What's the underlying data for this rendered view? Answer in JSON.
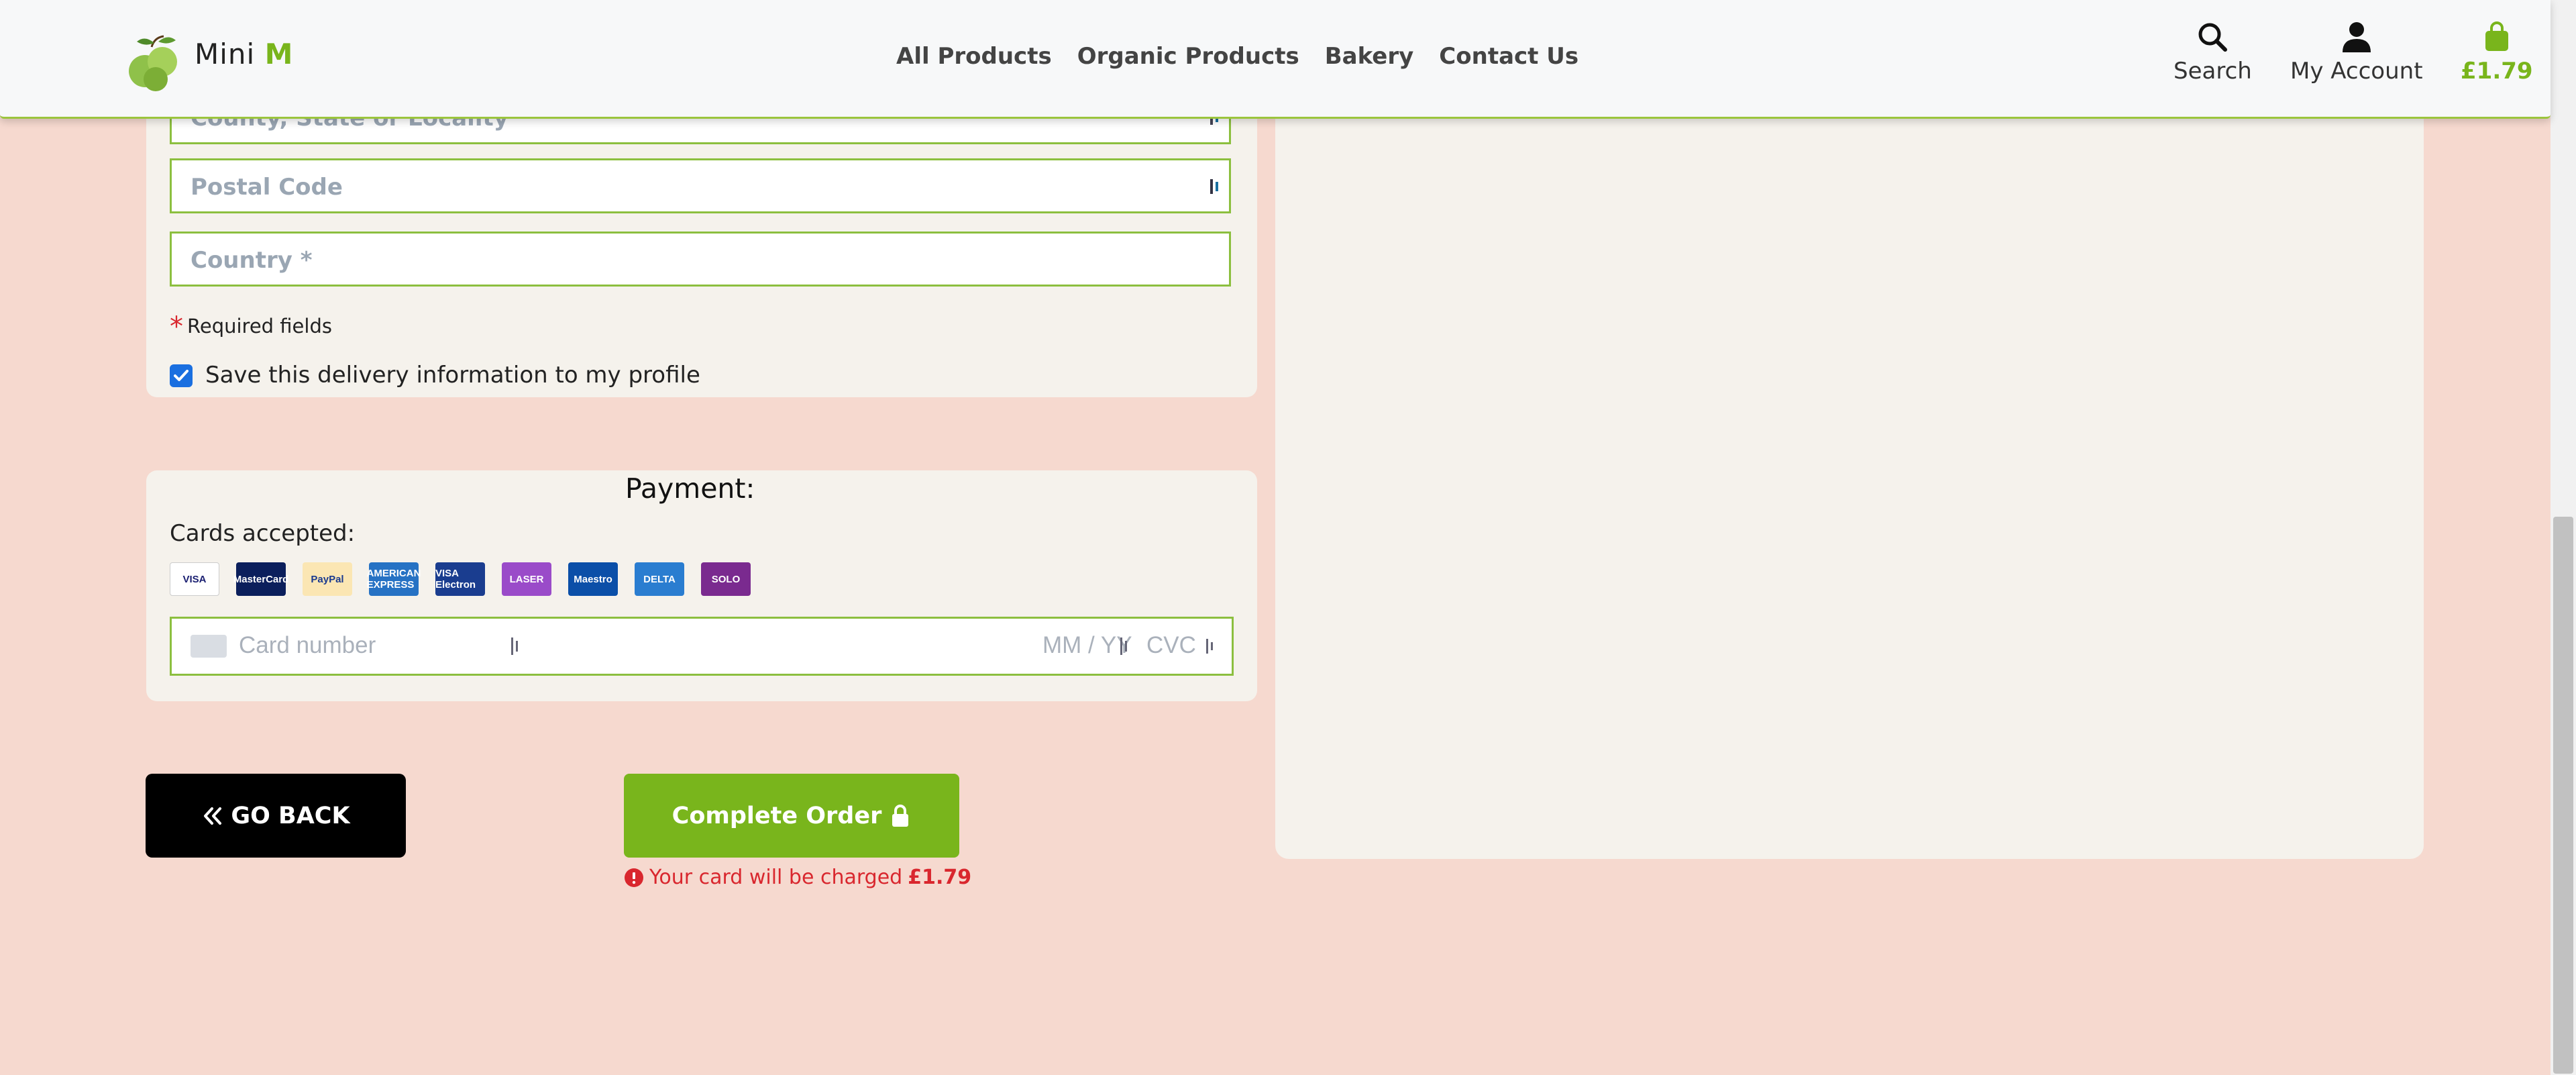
{
  "header": {
    "brand_text": "Mini",
    "brand_accent": "M",
    "nav": [
      "All Products",
      "Organic Products",
      "Bakery",
      "Contact Us"
    ],
    "search_label": "Search",
    "account_label": "My Account",
    "cart_total": "£1.79",
    "icons": {
      "logo": "green-apples-logo",
      "search": "search-icon",
      "account": "user-icon",
      "cart": "shopping-bag-icon"
    }
  },
  "delivery": {
    "county_placeholder": "County, State or Locality",
    "postal_placeholder": "Postal Code",
    "country_placeholder": "Country *",
    "required_text": "Required fields",
    "save_label": "Save this delivery information to my profile",
    "save_checked": true
  },
  "payment": {
    "title": "Payment:",
    "cards_accepted_label": "Cards accepted:",
    "cards": [
      {
        "name": "visa-card-icon",
        "text": "VISA",
        "bg": "#ffffff",
        "fg": "#1a1f71"
      },
      {
        "name": "mastercard-card-icon",
        "text": "MasterCard",
        "bg": "#0b1f5c",
        "fg": "#ffffff"
      },
      {
        "name": "paypal-card-icon",
        "text": "PayPal",
        "bg": "#fbe6b3",
        "fg": "#1a3a8f"
      },
      {
        "name": "amex-card-icon",
        "text": "AMERICAN EXPRESS",
        "bg": "#2672c4",
        "fg": "#ffffff"
      },
      {
        "name": "visa-electron-card-icon",
        "text": "VISA Electron",
        "bg": "#1a3d8f",
        "fg": "#ffffff"
      },
      {
        "name": "laser-card-icon",
        "text": "LASER",
        "bg": "#9a4bc9",
        "fg": "#ffffff"
      },
      {
        "name": "maestro-card-icon",
        "text": "Maestro",
        "bg": "#0b4fa8",
        "fg": "#ffffff"
      },
      {
        "name": "delta-card-icon",
        "text": "DELTA",
        "bg": "#2a7dd0",
        "fg": "#ffffff"
      },
      {
        "name": "solo-card-icon",
        "text": "SOLO",
        "bg": "#7a2a8f",
        "fg": "#ffffff"
      }
    ],
    "card_number_placeholder": "Card number",
    "expiry_placeholder": "MM / YY",
    "cvc_placeholder": "CVC"
  },
  "actions": {
    "back_label": "GO BACK",
    "complete_label": "Complete Order",
    "charge_text": "Your card will be charged",
    "charge_amount": "£1.79"
  },
  "colors": {
    "accent": "#79b51c",
    "page_bg": "#f6d9cf",
    "panel_bg": "#f5f2ec",
    "error": "#d9272e",
    "checkbox": "#1a6fe0"
  }
}
